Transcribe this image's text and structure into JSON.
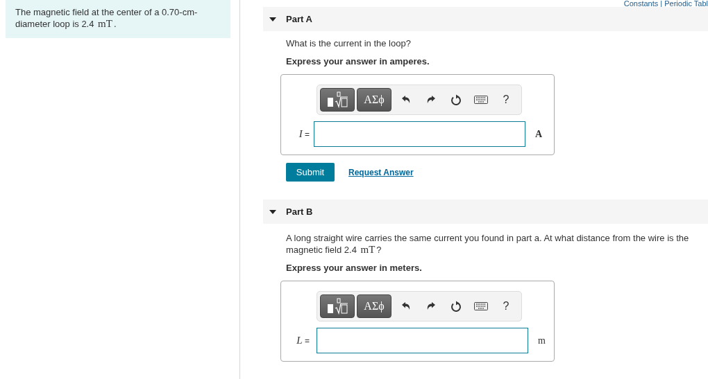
{
  "problem": {
    "statement": [
      {
        "kind": "text",
        "text": "The magnetic field at the center of a 0.70-cm-diameter loop is 2.4 "
      },
      {
        "kind": "math",
        "text": "mT"
      },
      {
        "kind": "text",
        "text": "."
      }
    ]
  },
  "top_links": {
    "text": "Constants | Periodic Tabl"
  },
  "parts": [
    {
      "label": "Part A",
      "expanded": true,
      "question": [
        {
          "kind": "text",
          "text": "What is the current in the loop?"
        }
      ],
      "instruction": "Express your answer in amperes.",
      "toolbar": {
        "symbols": "ΑΣϕ",
        "help": "?"
      },
      "variable": "I",
      "equals": "=",
      "unit": "A",
      "submit": "Submit",
      "request": "Request Answer"
    },
    {
      "label": "Part B",
      "expanded": true,
      "question": [
        {
          "kind": "text",
          "text": "A long straight wire carries the same current you found in part a. At what distance from the wire is the magnetic field 2.4 "
        },
        {
          "kind": "math",
          "text": "mT"
        },
        {
          "kind": "text",
          "text": "?"
        }
      ],
      "instruction": "Express your answer in meters.",
      "toolbar": {
        "symbols": "ΑΣϕ",
        "help": "?"
      },
      "variable": "L",
      "equals": "=",
      "unit": "m"
    }
  ]
}
